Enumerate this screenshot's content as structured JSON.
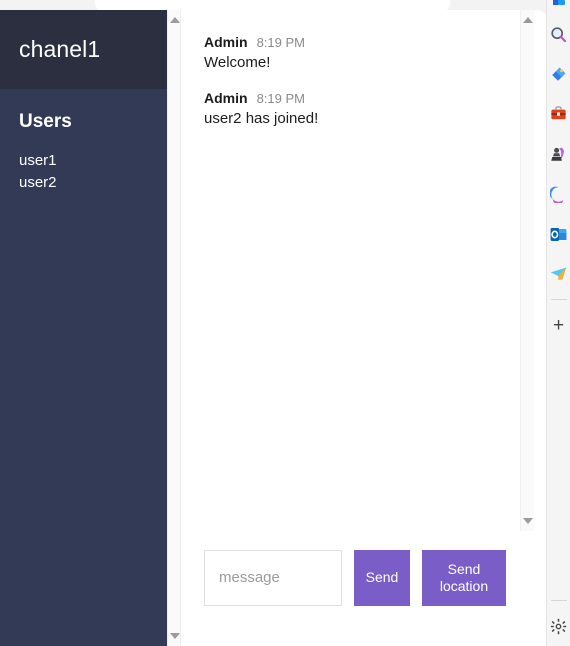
{
  "app": {
    "sidebar": {
      "channel_title": "chanel1",
      "users_heading": "Users",
      "users": [
        {
          "name": "user1"
        },
        {
          "name": "user2"
        }
      ]
    },
    "messages": [
      {
        "author": "Admin",
        "time": "8:19 PM",
        "text": "Welcome!"
      },
      {
        "author": "Admin",
        "time": "8:19 PM",
        "text": "user2 has joined!"
      }
    ],
    "composer": {
      "input_value": "",
      "input_placeholder": "message",
      "send_label": "Send",
      "send_location_label": "Send location"
    },
    "colors": {
      "sidebar_bg": "#333a56",
      "sidebar_header_bg": "#2b2f40",
      "button_purple": "#7b5dc7",
      "text_dark": "#1c1c1c",
      "text_muted": "#8a8a8a"
    }
  },
  "browser_sidebar": {
    "icons": [
      {
        "name": "search-icon"
      },
      {
        "name": "shopping-tag-icon"
      },
      {
        "name": "tools-briefcase-icon"
      },
      {
        "name": "games-icon"
      },
      {
        "name": "microsoft-365-icon"
      },
      {
        "name": "outlook-icon"
      },
      {
        "name": "paper-plane-icon"
      }
    ],
    "add_label": "+",
    "settings_name": "settings-gear-icon"
  }
}
